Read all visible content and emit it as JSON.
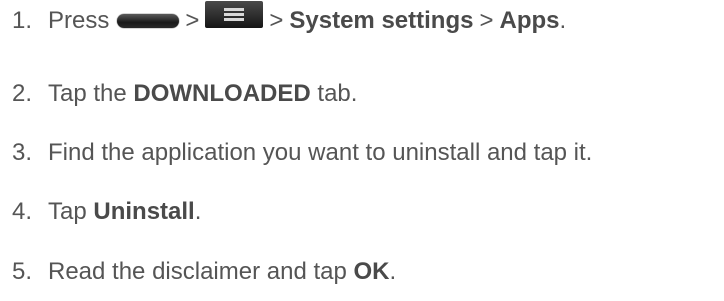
{
  "steps": [
    {
      "number": "1.",
      "text_press": "Press",
      "separator": ">",
      "home_key_icon": "home-key-icon",
      "menu_key_icon": "menu-icon",
      "system_settings": "System settings",
      "apps": "Apps",
      "end": "."
    },
    {
      "number": "2.",
      "before": "Tap the",
      "bold": "DOWNLOADED",
      "after": "tab."
    },
    {
      "number": "3.",
      "text": "Find the application you want to uninstall and tap it."
    },
    {
      "number": "4.",
      "before": "Tap",
      "bold": "Uninstall",
      "after": "."
    },
    {
      "number": "5.",
      "before": "Read the disclaimer and tap",
      "bold": "OK",
      "after": "."
    }
  ]
}
